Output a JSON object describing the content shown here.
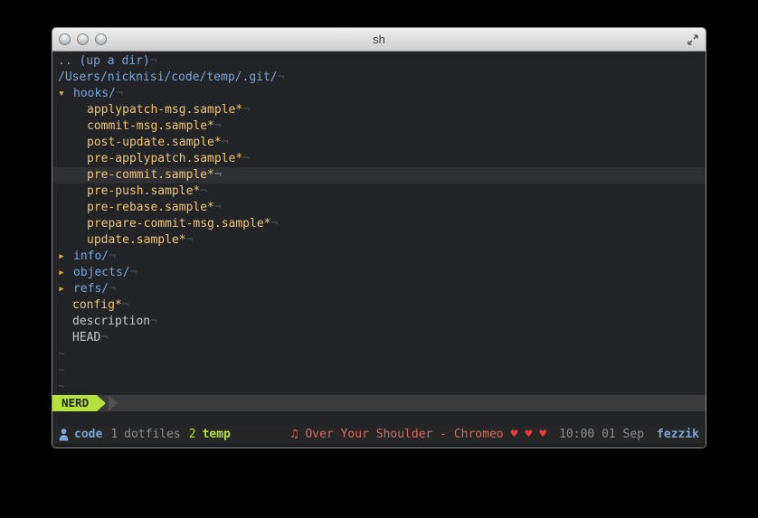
{
  "window": {
    "title": "sh",
    "traffic_lights": [
      "close",
      "minimize",
      "zoom"
    ]
  },
  "terminal": {
    "linebreak_char": "¬",
    "tilde_char": "~",
    "tilde_count": 3,
    "tree": [
      {
        "text": ".. (up a dir)",
        "color": "blue",
        "indent": 0
      },
      {
        "text": "/Users/nicknisi/code/temp/.git/",
        "color": "blue",
        "indent": 0
      },
      {
        "arrow": "▾",
        "text": "hooks/",
        "color": "blue",
        "indent": 0
      },
      {
        "text": "applypatch-msg.sample*",
        "color": "yellow",
        "indent": 2
      },
      {
        "text": "commit-msg.sample*",
        "color": "yellow",
        "indent": 2
      },
      {
        "text": "post-update.sample*",
        "color": "yellow",
        "indent": 2
      },
      {
        "text": "pre-applypatch.sample*",
        "color": "yellow",
        "indent": 2
      },
      {
        "text": "pre-commit.sample*",
        "color": "yellow",
        "indent": 2,
        "current": true
      },
      {
        "text": "pre-push.sample*",
        "color": "yellow",
        "indent": 2
      },
      {
        "text": "pre-rebase.sample*",
        "color": "yellow",
        "indent": 2
      },
      {
        "text": "prepare-commit-msg.sample*",
        "color": "yellow",
        "indent": 2
      },
      {
        "text": "update.sample*",
        "color": "yellow",
        "indent": 2
      },
      {
        "arrow": "▸",
        "text": "info/",
        "color": "blue",
        "indent": 0
      },
      {
        "arrow": "▸",
        "text": "objects/",
        "color": "blue",
        "indent": 0
      },
      {
        "arrow": "▸",
        "text": "refs/",
        "color": "blue",
        "indent": 0
      },
      {
        "text": "config*",
        "color": "yellow",
        "indent": 1
      },
      {
        "text": "description",
        "color": "white",
        "indent": 1
      },
      {
        "text": "HEAD",
        "color": "white",
        "indent": 1
      }
    ],
    "statusline": {
      "mode": "NERD"
    }
  },
  "tmux": {
    "session_icon": "person-icon",
    "session_name": "code",
    "windows": [
      {
        "index": "1",
        "name": "dotfiles",
        "active": false
      },
      {
        "index": "2",
        "name": "temp",
        "active": true
      }
    ],
    "music": {
      "icon": "♫",
      "title": "Over Your Shoulder - Chromeo",
      "hearts": [
        "♥",
        "♥",
        "♥"
      ]
    },
    "clock": "10:00 01 Sep",
    "host": "fezzik"
  },
  "palette": {
    "terminal_background": "#222427",
    "cursorline": "#2e3033",
    "blue": "#7aa6da",
    "yellow": "#f0c674",
    "lime_green": "#b5e13d",
    "red": "#d96a62",
    "heart_red": "#f03838"
  }
}
